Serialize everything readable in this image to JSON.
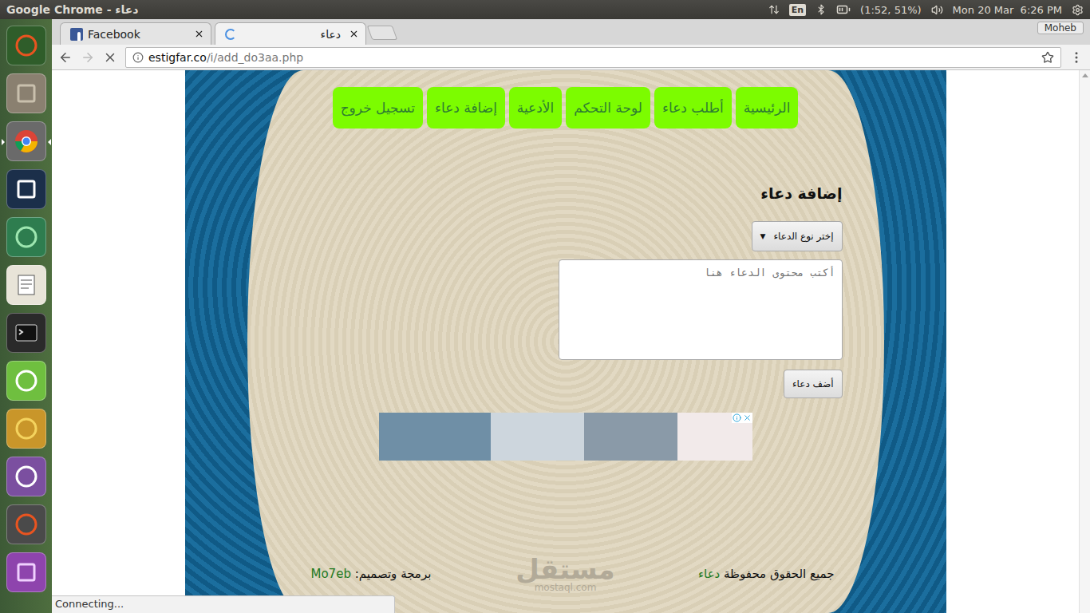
{
  "top_panel": {
    "title": "Google Chrome - دعاء",
    "keyboard": "En",
    "battery": "(1:52, 51%)",
    "clock": "Mon 20 Mar  6:26 PM"
  },
  "launcher": [
    {
      "running": false
    },
    {
      "running": false
    },
    {
      "running": true
    },
    {
      "running": false
    },
    {
      "running": false
    },
    {
      "running": false
    },
    {
      "running": false
    },
    {
      "running": false
    },
    {
      "running": false
    },
    {
      "running": false
    },
    {
      "running": false
    },
    {
      "running": false
    }
  ],
  "browser": {
    "tabs": [
      {
        "label": "Facebook",
        "selected": false,
        "loading": false
      },
      {
        "label": "دعاء",
        "selected": true,
        "loading": true
      }
    ],
    "profile": "Moheb",
    "address": {
      "host": "estigfar.co",
      "path": "/i/add_do3aa.php"
    },
    "loading": true,
    "status": "Connecting..."
  },
  "page": {
    "nav": [
      {
        "label": "الرئيسية"
      },
      {
        "label": "أطلب دعاء"
      },
      {
        "label": "لوحة التحكم"
      },
      {
        "label": "الأدعية"
      },
      {
        "label": "إضافة دعاء"
      },
      {
        "label": "تسجيل خروج"
      }
    ],
    "form": {
      "title": "إضافة دعاء",
      "select": "إختر نوع الدعاء",
      "select_arrow": "▼",
      "placeholder": "أكتب محتوى الدعاء هنا",
      "submit": "أضف دعاء"
    },
    "footer": {
      "rights": "جميع الحقوق محفوظة",
      "rights_link": "دعاء",
      "credit": "برمجة وتصميم:",
      "credit_link": "Mo7eb"
    },
    "watermark": {
      "arabic": "مستقل",
      "latin": "mostaql.com"
    }
  }
}
